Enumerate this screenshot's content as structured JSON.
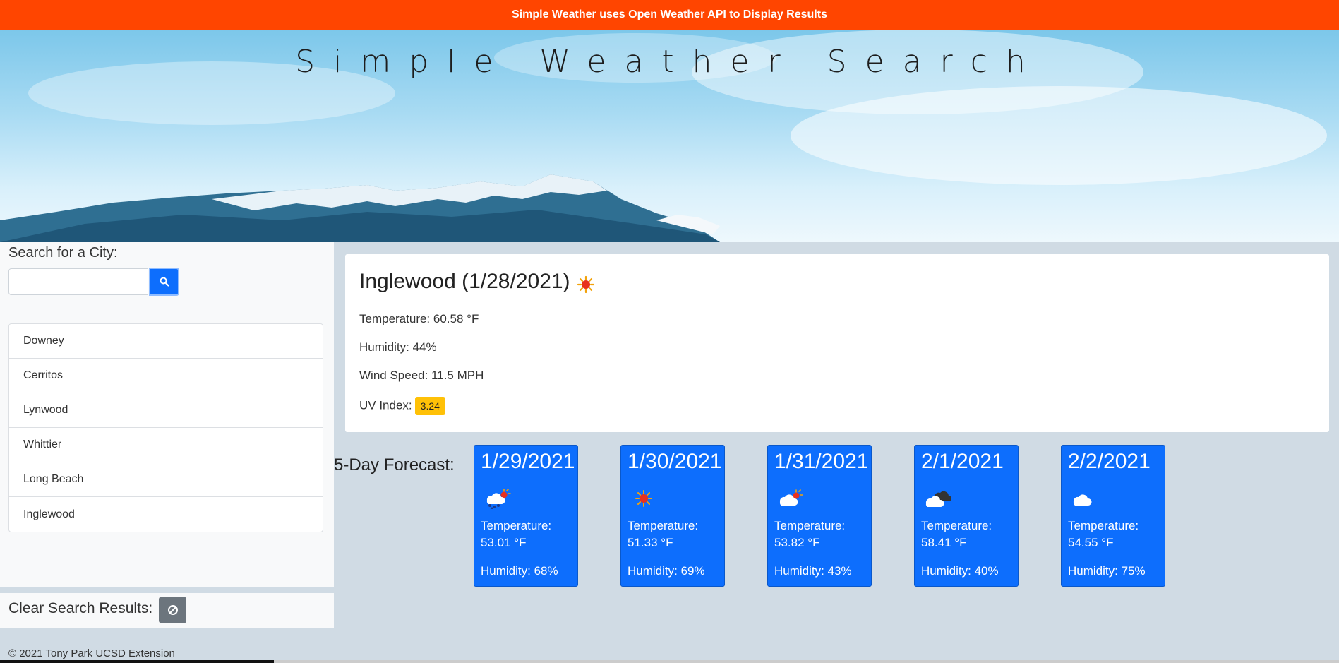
{
  "banner": {
    "text": "Simple Weather uses Open Weather API to Display Results"
  },
  "header": {
    "title": "Simple Weather Search"
  },
  "sidebar": {
    "search_label": "Search for a City:",
    "search_value": "",
    "cities": [
      "Downey",
      "Cerritos",
      "Lynwood",
      "Whittier",
      "Long Beach",
      "Inglewood"
    ],
    "clear_label": "Clear Search Results:"
  },
  "current": {
    "title": "Inglewood (1/28/2021)",
    "icon": "sun-icon",
    "temperature": "Temperature: 60.58 °F",
    "humidity": "Humidity: 44%",
    "wind": "Wind Speed: 11.5 MPH",
    "uv_label": "UV Index:",
    "uv_value": "3.24"
  },
  "forecast": {
    "label": "5-Day Forecast:",
    "days": [
      {
        "date": "1/29/2021",
        "icon": "rain-sun-icon",
        "temp_label": "Temperature:",
        "temp": "53.01 °F",
        "humidity": "Humidity: 68%"
      },
      {
        "date": "1/30/2021",
        "icon": "sun-icon",
        "temp_label": "Temperature:",
        "temp": "51.33 °F",
        "humidity": "Humidity: 69%"
      },
      {
        "date": "1/31/2021",
        "icon": "cloud-sun-icon",
        "temp_label": "Temperature:",
        "temp": "53.82 °F",
        "humidity": "Humidity: 43%"
      },
      {
        "date": "2/1/2021",
        "icon": "broken-clouds-icon",
        "temp_label": "Temperature:",
        "temp": "58.41 °F",
        "humidity": "Humidity: 40%"
      },
      {
        "date": "2/2/2021",
        "icon": "cloud-icon",
        "temp_label": "Temperature:",
        "temp": "54.55 °F",
        "humidity": "Humidity: 75%"
      }
    ]
  },
  "footer": {
    "text": "© 2021 Tony Park UCSD Extension"
  },
  "colors": {
    "banner": "#ff4500",
    "accent": "#0d6efd",
    "uv": "#ffc107",
    "page_bg": "#d0dbe4"
  }
}
